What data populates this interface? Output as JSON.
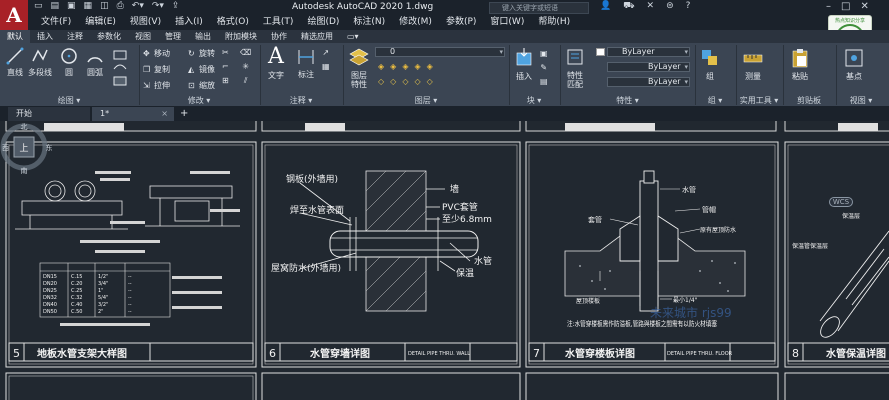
{
  "app": {
    "logo_letter": "A",
    "window_title": "Autodesk AutoCAD 2020    1.dwg",
    "search_placeholder": "键入关键字或短语",
    "menus": [
      "文件(F)",
      "编辑(E)",
      "视图(V)",
      "插入(I)",
      "格式(O)",
      "工具(T)",
      "绘图(D)",
      "标注(N)",
      "修改(M)",
      "参数(P)",
      "窗口(W)",
      "帮助(H)"
    ],
    "brand_badge_text": "热点知识分享"
  },
  "ribbon": {
    "tabs": [
      "默认",
      "插入",
      "注释",
      "参数化",
      "视图",
      "管理",
      "输出",
      "附加模块",
      "协作",
      "精选应用"
    ],
    "active_tab": "默认",
    "draw": {
      "label": "绘图",
      "tools": [
        "直线",
        "多段线",
        "圆",
        "圆弧"
      ]
    },
    "modify": {
      "label": "修改",
      "tools": [
        "移动",
        "旋转",
        "复制",
        "镜像",
        "拉伸",
        "缩放"
      ]
    },
    "annotation": {
      "label": "注释",
      "tools": [
        "文字",
        "标注"
      ]
    },
    "layers": {
      "label": "图层",
      "big_tool": "图层\n特性",
      "current_layer": "0"
    },
    "block": {
      "label": "块",
      "tool": "插入"
    },
    "properties": {
      "label": "特性",
      "big_tool": "特性\n匹配",
      "color": "ByLayer",
      "linetype": "ByLayer",
      "lineweight": "ByLayer"
    },
    "groups": {
      "label": "组",
      "tool": "组"
    },
    "utilities": {
      "label": "实用工具",
      "tool": "测量"
    },
    "clipboard": {
      "label": "剪贴板",
      "tool": "粘贴"
    },
    "view": {
      "label": "视图",
      "tool": "基点"
    }
  },
  "doc_tabs": {
    "start": "开始",
    "drawing": "1*"
  },
  "drawings": [
    {
      "number": "5",
      "title": "地板水管支架大样图",
      "table_rows": [
        [
          "DN15",
          "C.15",
          "1/2\"",
          "--"
        ],
        [
          "DN20",
          "C.20",
          "3/4\"",
          "--"
        ],
        [
          "DN25",
          "C.25",
          "1\"",
          "--"
        ],
        [
          "DN32",
          "C.32",
          "5/4\"",
          "--"
        ],
        [
          "DN40",
          "C.40",
          "3/2\"",
          "--"
        ],
        [
          "DN50",
          "C.50",
          "2\"",
          "--"
        ]
      ]
    },
    {
      "number": "6",
      "title": "水管穿墙详图",
      "subtitle": "DETAIL PIPE THRU. WALL",
      "labels_left": [
        "钢板(外墙用)",
        "焊至水管表面",
        "屋窝防水(外墙用)"
      ],
      "labels_right": [
        "墙",
        "PVC套管",
        "至少6.8mm",
        "水管",
        "保温"
      ]
    },
    {
      "number": "7",
      "title": "水管穿楼板详图",
      "subtitle": "DETAIL PIPE THRU. FLOOR",
      "labels": [
        "水管",
        "套管",
        "管帽",
        "原有屋顶防水",
        "屋顶楼板",
        "最小1/4\""
      ],
      "note": "注:水管穿楼板需作防溢板,管路與楼板之間需有以防火材填塞"
    },
    {
      "number": "8",
      "title": "水管保温详图",
      "labels": [
        "保温层",
        "保温管保温层"
      ]
    }
  ],
  "viewcube": {
    "top": "上",
    "north": "北",
    "south": "南",
    "east": "东",
    "west": "西",
    "wcs": "WCS"
  },
  "watermark": "未来城市 rjs99"
}
